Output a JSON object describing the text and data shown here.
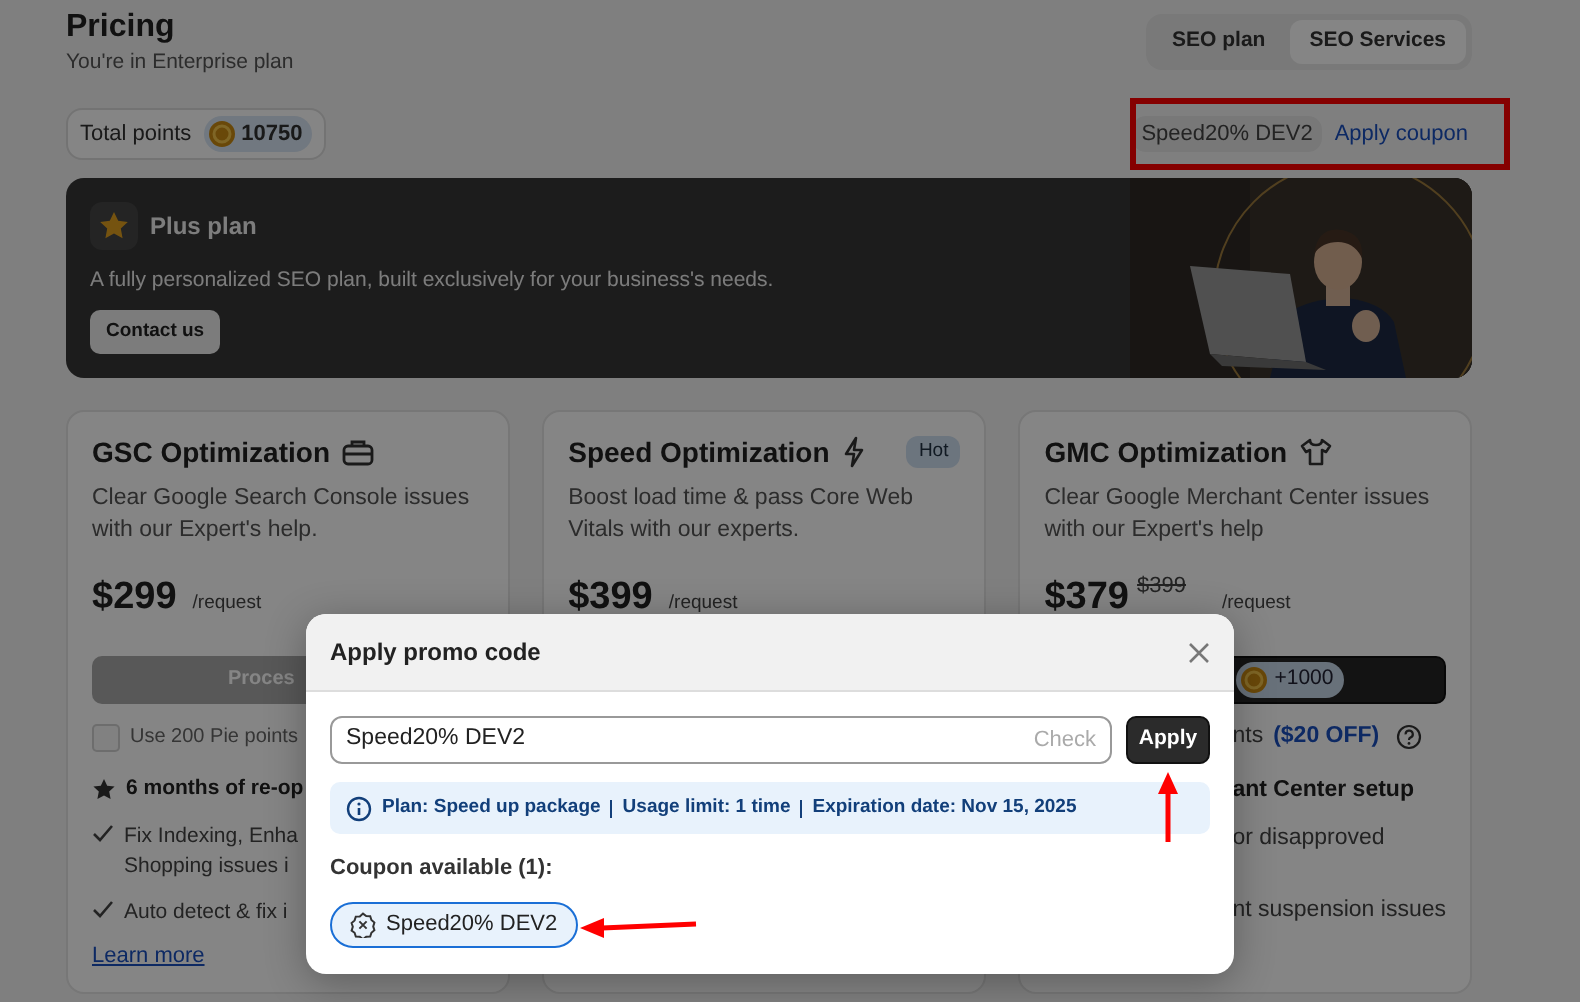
{
  "header": {
    "title": "Pricing",
    "subtitle": "You're in Enterprise plan"
  },
  "tabs": [
    {
      "label": "SEO plan",
      "selected": false
    },
    {
      "label": "SEO Services",
      "selected": true
    }
  ],
  "points": {
    "label": "Total points",
    "value": "10750"
  },
  "coupon_bar": {
    "code": "Speed20% DEV2",
    "link": "Apply coupon"
  },
  "banner": {
    "title": "Plus plan",
    "text": "A fully personalized SEO plan, built exclusively for your business's needs.",
    "button": "Contact us"
  },
  "cards": [
    {
      "title": "GSC Optimization",
      "description": "Clear Google Search Console issues with our Expert's help.",
      "price": "$299",
      "unit": "/request",
      "button": "Proces",
      "points_option": {
        "label": "Use 200 Pie points",
        "checked": false
      },
      "highlight": "6 months of re-op",
      "features": [
        {
          "lines": [
            "Fix Indexing, Enha",
            "Shopping issues i"
          ]
        },
        {
          "lines": [
            "Auto detect & fix i"
          ]
        }
      ],
      "link": "Learn more"
    },
    {
      "title": "Speed Optimization",
      "badge": "Hot",
      "description": "Boost load time & pass Core Web Vitals with our experts.",
      "price": "$399",
      "unit": "/request"
    },
    {
      "title": "GMC Optimization",
      "description": "Clear Google Merchant Center issues with our Expert's help",
      "price": "$379",
      "old_price": "$399",
      "unit": "/request",
      "button_points": "+1000",
      "points_option": {
        "label": "nts",
        "discount": "($20 OFF)"
      },
      "highlight": "ant Center setup",
      "features": [
        {
          "lines": [
            "or disapproved"
          ]
        },
        {
          "lines": [
            "nt suspension issues"
          ]
        }
      ]
    }
  ],
  "modal": {
    "title": "Apply promo code",
    "input_value": "Speed20% DEV2",
    "check_label": "Check",
    "apply_label": "Apply",
    "info": [
      "Plan: Speed up package",
      "Usage limit: 1 time",
      "Expiration date: Nov 15, 2025"
    ],
    "coupons_label": "Coupon available (1):",
    "coupons": [
      {
        "code": "Speed20% DEV2",
        "selected": true
      }
    ]
  }
}
